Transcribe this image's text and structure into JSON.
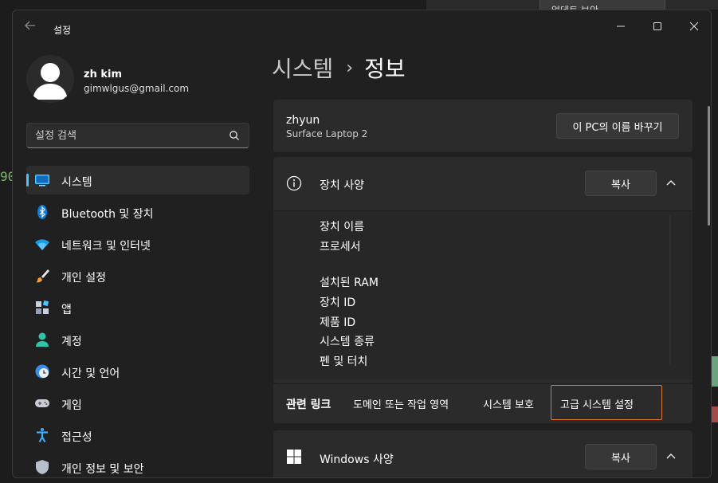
{
  "window": {
    "title": "설정",
    "controls": {
      "minimize": "minimize-icon",
      "maximize": "maximize-icon",
      "close": "close-icon"
    }
  },
  "background": {
    "popup_text": "업데트 보안",
    "left_number": "90"
  },
  "profile": {
    "name": "zh kim",
    "email": "gimwlgus@gmail.com"
  },
  "search": {
    "placeholder": "설정 검색"
  },
  "sidebar": {
    "items": [
      {
        "label": "시스템",
        "icon": "monitor-icon",
        "selected": true
      },
      {
        "label": "Bluetooth 및 장치",
        "icon": "bluetooth-icon"
      },
      {
        "label": "네트워크 및 인터넷",
        "icon": "wifi-icon"
      },
      {
        "label": "개인 설정",
        "icon": "brush-icon"
      },
      {
        "label": "앱",
        "icon": "apps-icon"
      },
      {
        "label": "계정",
        "icon": "person-icon"
      },
      {
        "label": "시간 및 언어",
        "icon": "clock-globe-icon"
      },
      {
        "label": "게임",
        "icon": "gamepad-icon"
      },
      {
        "label": "접근성",
        "icon": "accessibility-icon"
      },
      {
        "label": "개인 정보 및 보안",
        "icon": "shield-icon"
      }
    ]
  },
  "breadcrumb": {
    "parent": "시스템",
    "separator": "›",
    "current": "정보"
  },
  "pc": {
    "name": "zhyun",
    "model": "Surface Laptop 2",
    "rename_label": "이 PC의 이름 바꾸기"
  },
  "device_specs": {
    "title": "장치 사양",
    "copy_label": "복사",
    "rows": [
      "장치 이름",
      "프로세서",
      "설치된 RAM",
      "장치 ID",
      "제품 ID",
      "시스템 종류",
      "펜 및 터치"
    ]
  },
  "related_links": {
    "label": "관련 링크",
    "links": [
      "도메인 또는 작업 영역",
      "시스템 보호",
      "고급 시스템 설정"
    ]
  },
  "windows_specs": {
    "title": "Windows 사양",
    "copy_label": "복사"
  },
  "colors": {
    "accent": "#4cc2ff",
    "focus_outline": "#e8712a",
    "background": "#202020",
    "card": "#2b2b2b"
  }
}
